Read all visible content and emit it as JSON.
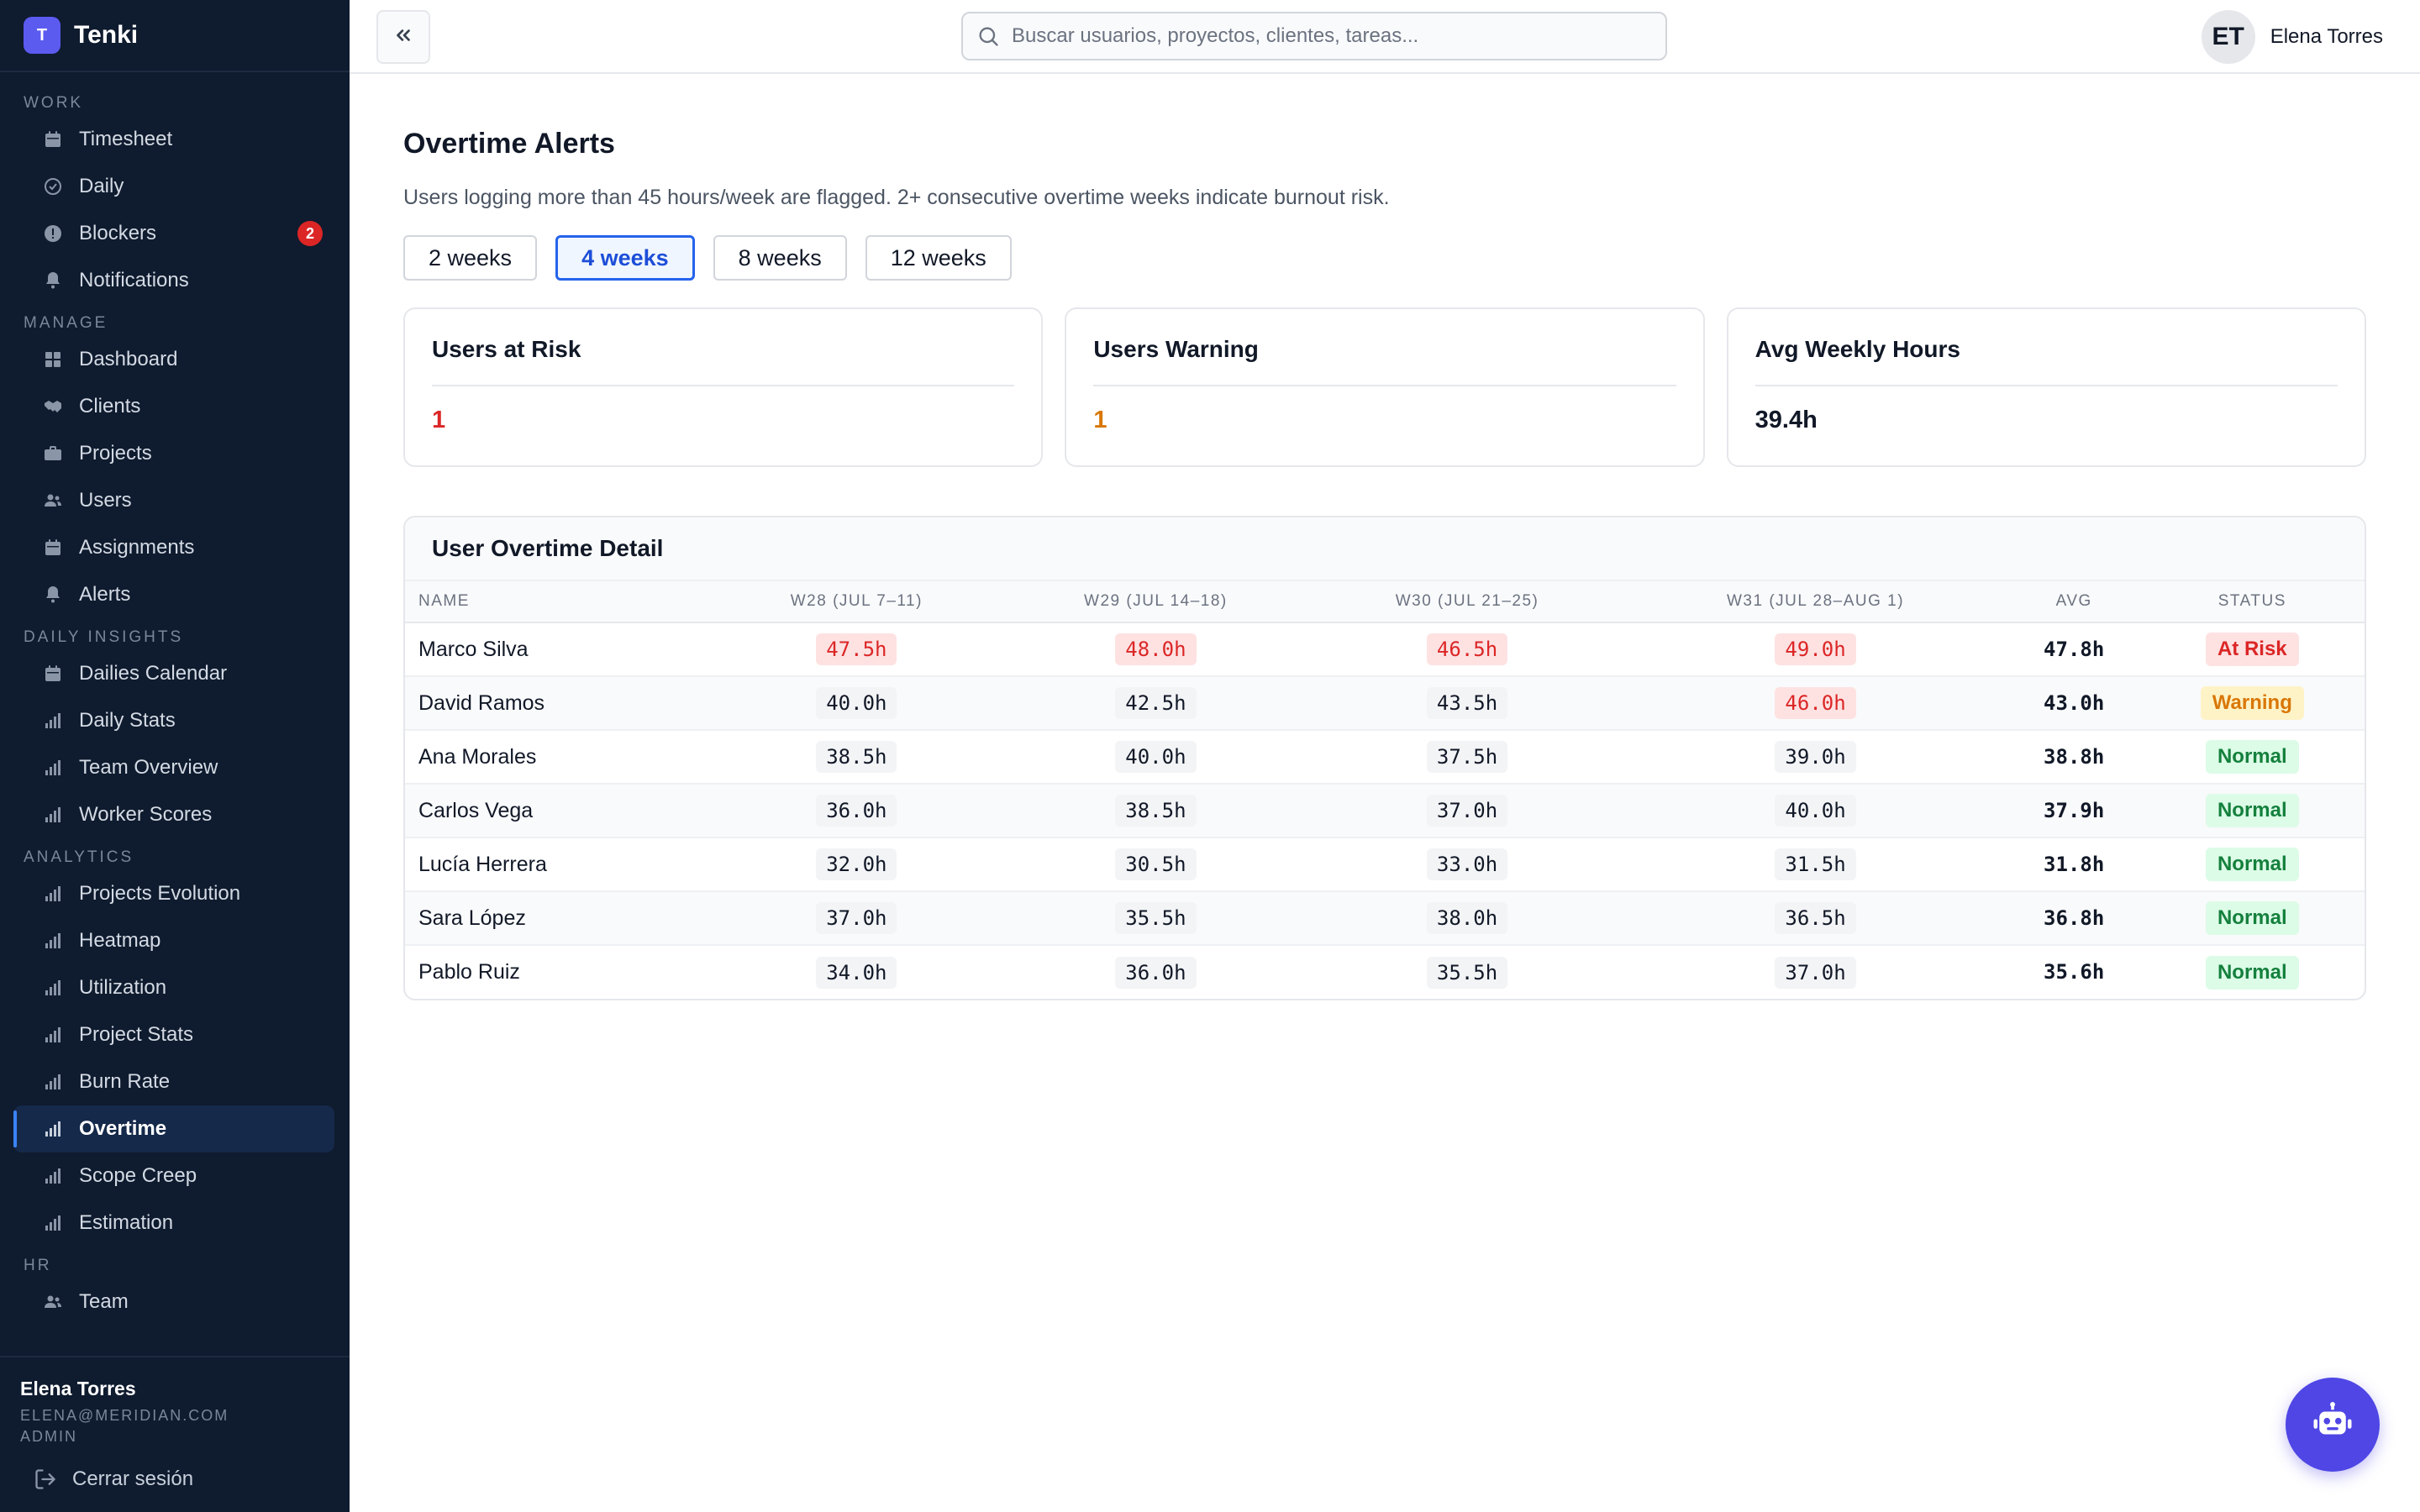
{
  "brand": {
    "logo_letter": "T",
    "name": "Tenki"
  },
  "sidebar": {
    "sections": [
      {
        "title": "WORK",
        "items": [
          {
            "label": "Timesheet",
            "icon": "calendar-icon"
          },
          {
            "label": "Daily",
            "icon": "check-circle-icon"
          },
          {
            "label": "Blockers",
            "icon": "alert-circle-icon",
            "badge": "2"
          },
          {
            "label": "Notifications",
            "icon": "bell-icon"
          }
        ]
      },
      {
        "title": "MANAGE",
        "items": [
          {
            "label": "Dashboard",
            "icon": "grid-icon"
          },
          {
            "label": "Clients",
            "icon": "handshake-icon"
          },
          {
            "label": "Projects",
            "icon": "briefcase-icon"
          },
          {
            "label": "Users",
            "icon": "users-icon"
          },
          {
            "label": "Assignments",
            "icon": "calendar-icon"
          },
          {
            "label": "Alerts",
            "icon": "bell-icon"
          }
        ]
      },
      {
        "title": "DAILY INSIGHTS",
        "items": [
          {
            "label": "Dailies Calendar",
            "icon": "calendar-icon"
          },
          {
            "label": "Daily Stats",
            "icon": "bar-chart-icon"
          },
          {
            "label": "Team Overview",
            "icon": "bar-chart-icon"
          },
          {
            "label": "Worker Scores",
            "icon": "bar-chart-icon"
          }
        ]
      },
      {
        "title": "ANALYTICS",
        "items": [
          {
            "label": "Projects Evolution",
            "icon": "bar-chart-icon"
          },
          {
            "label": "Heatmap",
            "icon": "bar-chart-icon"
          },
          {
            "label": "Utilization",
            "icon": "bar-chart-icon"
          },
          {
            "label": "Project Stats",
            "icon": "bar-chart-icon"
          },
          {
            "label": "Burn Rate",
            "icon": "bar-chart-icon"
          },
          {
            "label": "Overtime",
            "icon": "bar-chart-icon",
            "active": true
          },
          {
            "label": "Scope Creep",
            "icon": "bar-chart-icon"
          },
          {
            "label": "Estimation",
            "icon": "bar-chart-icon"
          }
        ]
      },
      {
        "title": "HR",
        "items": [
          {
            "label": "Team",
            "icon": "users-icon"
          }
        ]
      }
    ]
  },
  "footer_user": {
    "name": "Elena Torres",
    "email": "ELENA@MERIDIAN.COM",
    "role": "ADMIN",
    "logout_label": "Cerrar sesión"
  },
  "topbar": {
    "search_placeholder": "Buscar usuarios, proyectos, clientes, tareas...",
    "avatar_initials": "ET",
    "user_name": "Elena Torres"
  },
  "page": {
    "title": "Overtime Alerts",
    "description": "Users logging more than 45 hours/week are flagged. 2+ consecutive overtime weeks indicate burnout risk.",
    "tabs": [
      {
        "label": "2 weeks",
        "active": false
      },
      {
        "label": "4 weeks",
        "active": true
      },
      {
        "label": "8 weeks",
        "active": false
      },
      {
        "label": "12 weeks",
        "active": false
      }
    ]
  },
  "cards": [
    {
      "title": "Users at Risk",
      "value": "1",
      "color": "#dc2626"
    },
    {
      "title": "Users Warning",
      "value": "1",
      "color": "#d97706"
    },
    {
      "title": "Avg Weekly Hours",
      "value": "39.4h",
      "color": "#111827"
    }
  ],
  "table": {
    "title": "User Overtime Detail",
    "columns": [
      "NAME",
      "W28 (JUL 7–11)",
      "W29 (JUL 14–18)",
      "W30 (JUL 21–25)",
      "W31 (JUL 28–AUG 1)",
      "AVG",
      "STATUS"
    ],
    "rows": [
      {
        "name": "Marco Silva",
        "weeks": [
          "47.5h",
          "48.0h",
          "46.5h",
          "49.0h"
        ],
        "flags": [
          true,
          true,
          true,
          true
        ],
        "avg": "47.8h",
        "status": "At Risk",
        "status_kind": "risk"
      },
      {
        "name": "David Ramos",
        "weeks": [
          "40.0h",
          "42.5h",
          "43.5h",
          "46.0h"
        ],
        "flags": [
          false,
          false,
          false,
          true
        ],
        "avg": "43.0h",
        "status": "Warning",
        "status_kind": "warn"
      },
      {
        "name": "Ana Morales",
        "weeks": [
          "38.5h",
          "40.0h",
          "37.5h",
          "39.0h"
        ],
        "flags": [
          false,
          false,
          false,
          false
        ],
        "avg": "38.8h",
        "status": "Normal",
        "status_kind": "normal"
      },
      {
        "name": "Carlos Vega",
        "weeks": [
          "36.0h",
          "38.5h",
          "37.0h",
          "40.0h"
        ],
        "flags": [
          false,
          false,
          false,
          false
        ],
        "avg": "37.9h",
        "status": "Normal",
        "status_kind": "normal"
      },
      {
        "name": "Lucía Herrera",
        "weeks": [
          "32.0h",
          "30.5h",
          "33.0h",
          "31.5h"
        ],
        "flags": [
          false,
          false,
          false,
          false
        ],
        "avg": "31.8h",
        "status": "Normal",
        "status_kind": "normal"
      },
      {
        "name": "Sara López",
        "weeks": [
          "37.0h",
          "35.5h",
          "38.0h",
          "36.5h"
        ],
        "flags": [
          false,
          false,
          false,
          false
        ],
        "avg": "36.8h",
        "status": "Normal",
        "status_kind": "normal"
      },
      {
        "name": "Pablo Ruiz",
        "weeks": [
          "34.0h",
          "36.0h",
          "35.5h",
          "37.0h"
        ],
        "flags": [
          false,
          false,
          false,
          false
        ],
        "avg": "35.6h",
        "status": "Normal",
        "status_kind": "normal"
      }
    ]
  },
  "fab": {
    "icon": "robot-icon"
  }
}
